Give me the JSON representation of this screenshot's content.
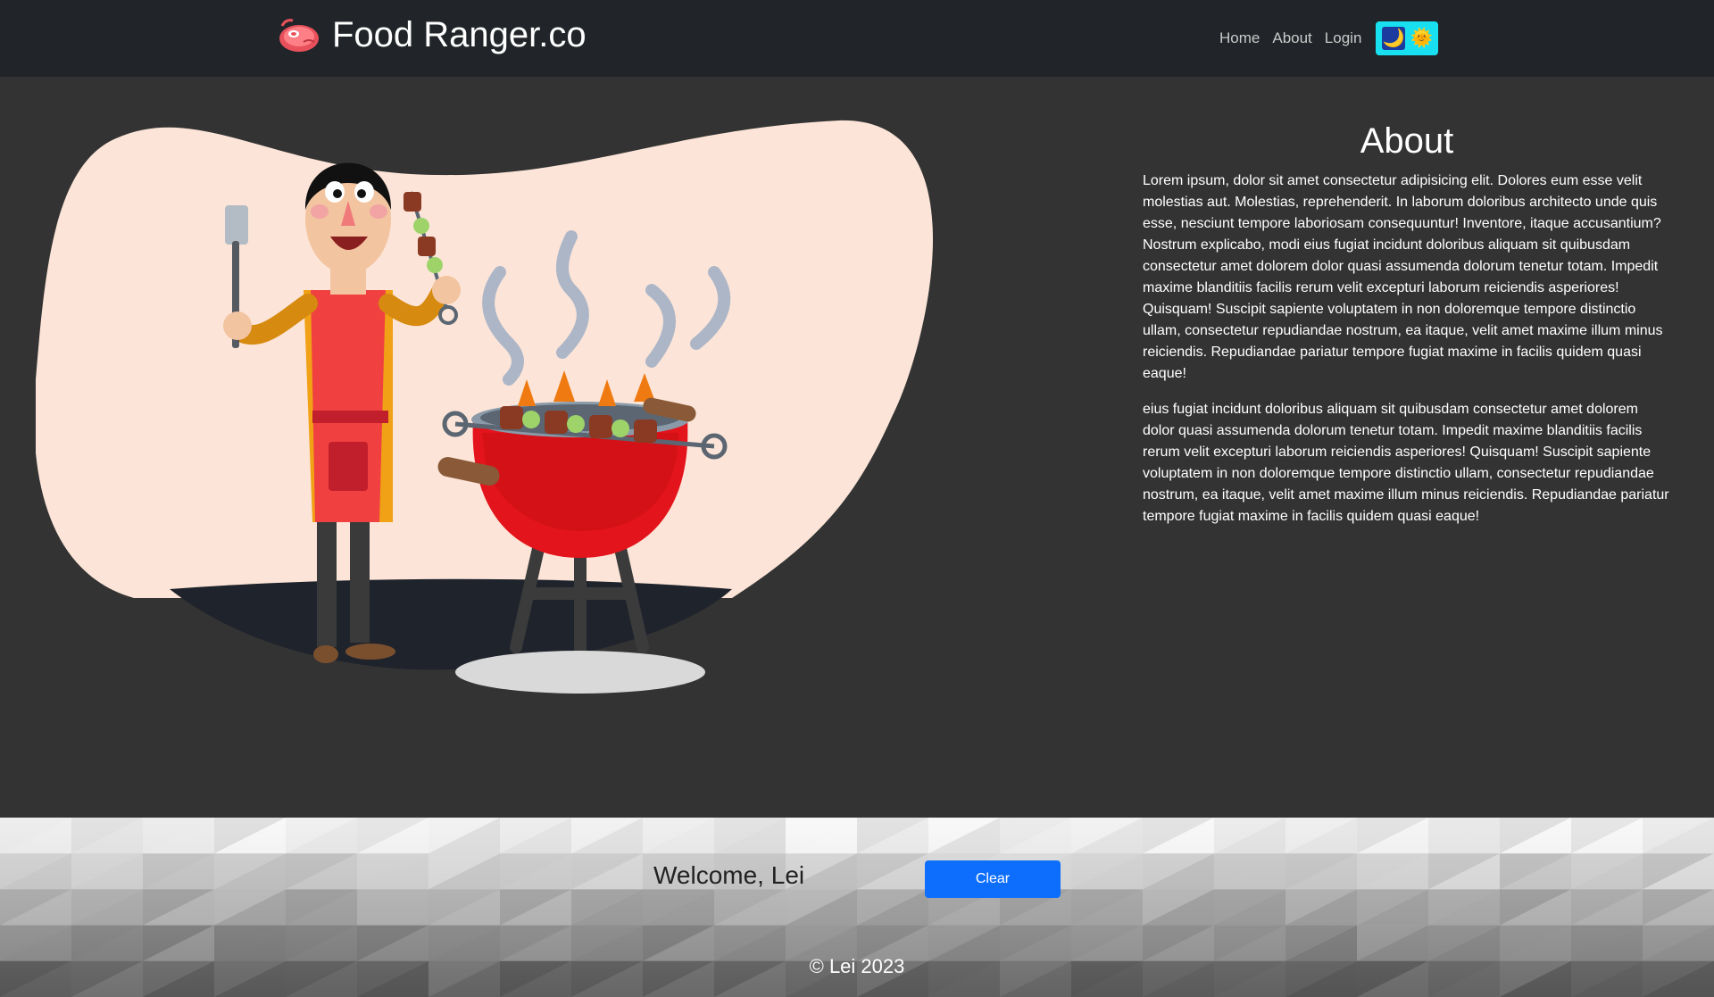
{
  "header": {
    "brand": "Food Ranger.co",
    "logo_icon": "steak-icon",
    "nav": [
      {
        "label": "Home"
      },
      {
        "label": "About"
      },
      {
        "label": "Login"
      }
    ],
    "theme_toggle": {
      "dark_icon": "🌙",
      "light_icon": "🌞"
    }
  },
  "about": {
    "title": "About",
    "paragraphs": [
      "Lorem ipsum, dolor sit amet consectetur adipisicing elit. Dolores eum esse velit molestias aut. Molestias, reprehenderit. In laborum doloribus architecto unde quis esse, nesciunt tempore laboriosam consequuntur! Inventore, itaque accusantium? Nostrum explicabo, modi eius fugiat incidunt doloribus aliquam sit quibusdam consectetur amet dolorem dolor quasi assumenda dolorum tenetur totam. Impedit maxime blanditiis facilis rerum velit excepturi laborum reiciendis asperiores! Quisquam! Suscipit sapiente voluptatem in non doloremque tempore distinctio ullam, consectetur repudiandae nostrum, ea itaque, velit amet maxime illum minus reiciendis. Repudiandae pariatur tempore fugiat maxime in facilis quidem quasi eaque!",
      "eius fugiat incidunt doloribus aliquam sit quibusdam consectetur amet dolorem dolor quasi assumenda dolorum tenetur totam. Impedit maxime blanditiis facilis rerum velit excepturi laborum reiciendis asperiores! Quisquam! Suscipit sapiente voluptatem in non doloremque tempore distinctio ullam, consectetur repudiandae nostrum, ea itaque, velit amet maxime illum minus reiciendis. Repudiandae pariatur tempore fugiat maxime in facilis quidem quasi eaque!"
    ]
  },
  "footer": {
    "welcome": "Welcome, Lei",
    "clear_label": "Clear",
    "copyright": "© Lei 2023"
  },
  "colors": {
    "navbar": "#212529",
    "page_bg": "#333333",
    "blob": "#fce5d8",
    "accent_toggle": "#19e0f0",
    "button": "#0d6efd"
  }
}
